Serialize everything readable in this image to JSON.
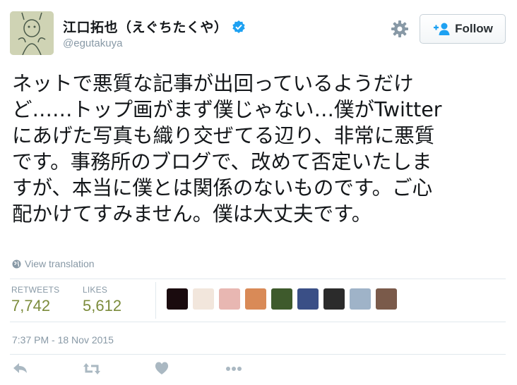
{
  "author": {
    "display_name": "江口拓也（えぐちたくや）",
    "handle": "@egutakuya",
    "verified_icon": "verified-badge-icon"
  },
  "header": {
    "follow_label": "Follow",
    "settings_icon": "gear-icon"
  },
  "tweet": {
    "lines": [
      "ネットで悪質な記事が出回っているようだけ",
      "ど……トップ画がまず僕じゃない…僕がTwitter",
      "にあげた写真も織り交ぜてる辺り、非常に悪質",
      "です。事務所のブログで、改めて否定いたしま",
      "すが、本当に僕とは関係のないものです。ご心",
      "配かけてすみません。僕は大丈夫です。"
    ],
    "translation_label": "View translation"
  },
  "stats": {
    "retweets_label": "RETWEETS",
    "retweets_value": "7,742",
    "likes_label": "LIKES",
    "likes_value": "5,612"
  },
  "likers": [
    {
      "color": "#1a0b0e"
    },
    {
      "color": "#f2e6dc"
    },
    {
      "color": "#e8b7b2"
    },
    {
      "color": "#d98a57"
    },
    {
      "color": "#3e5a2c"
    },
    {
      "color": "#3a4f86"
    },
    {
      "color": "#2b2b2b"
    },
    {
      "color": "#9fb3c8"
    },
    {
      "color": "#7a5a4a"
    }
  ],
  "timestamp": "7:37 PM - 18 Nov 2015",
  "actions": [
    "reply-icon",
    "retweet-icon",
    "like-icon",
    "more-icon"
  ],
  "colors": {
    "muted": "#8899a6",
    "verified_blue": "#1da1f2",
    "count_green": "#7c8c3c"
  }
}
